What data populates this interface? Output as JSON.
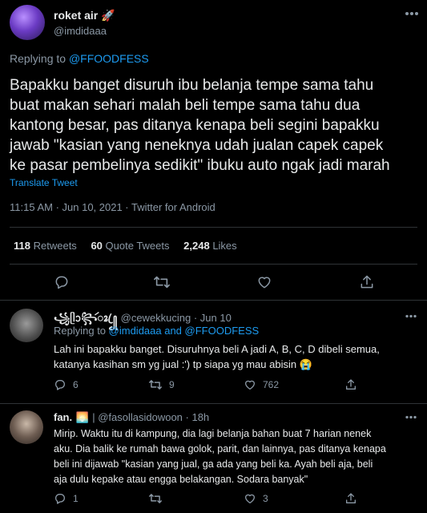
{
  "tweet": {
    "author_name": "roket air",
    "author_emoji": "🚀",
    "author_handle": "@imdidaaa",
    "replying_prefix": "Replying to ",
    "replying_to": "@FFOODFESS",
    "text_lines": [
      "Bapakku banget disuruh ibu belanja tempe sama tahu",
      "buat makan sehari malah beli tempe sama tahu dua",
      "kantong besar, pas ditanya kenapa beli segini bapakku",
      "jawab \"kasian yang neneknya udah jualan capek capek",
      "ke pasar pembelinya sedikit\" ibuku auto ngak jadi marah"
    ],
    "translate_label": "Translate Tweet",
    "timestamp": "11:15 AM · Jun 10, 2021 · Twitter for Android",
    "retweets_count": "118",
    "retweets_label": "Retweets",
    "quotes_count": "60",
    "quotes_label": "Quote Tweets",
    "likes_count": "2,248",
    "likes_label": "Likes"
  },
  "replies": [
    {
      "author_name": "꧁ᥫᩣ꧂ꦂꦴ ꦿ꧀",
      "author_handle": "@cewekkucing · Jun 10",
      "replying_prefix": "Replying to ",
      "replying_to": "@imdidaaa and @FFOODFESS",
      "text_lines": [
        "Lah ini bapakku banget. Disuruhnya beli A jadi A, B, C, D dibeli semua,",
        "katanya kasihan sm yg jual :') tp siapa yg mau abisin 😭"
      ],
      "reply_count": "6",
      "retweet_count": "9",
      "like_count": "762"
    },
    {
      "author_name": "fan.",
      "author_emoji": "🌅",
      "author_handle": "| @fasollasidowoon · 18h",
      "text_lines": [
        "Mirip. Waktu itu di kampung, dia lagi belanja bahan buat 7 harian nenek",
        "aku. Dia balik ke rumah bawa golok, parit, dan lainnya, pas ditanya kenapa",
        "beli ini dijawab \"kasian yang jual, ga ada yang beli ka. Ayah beli aja, beli",
        "aja dulu kepake atau engga belakangan. Sodara banyak\""
      ],
      "reply_count": "1",
      "retweet_count": "",
      "like_count": "3"
    }
  ],
  "icons": {
    "more": "more-icon",
    "reply": "reply-icon",
    "retweet": "retweet-icon",
    "like": "like-icon",
    "share": "share-icon"
  },
  "colors": {
    "background": "#000000",
    "link": "#1d9bf0",
    "text": "#e7e9ea",
    "muted": "#8b98a5",
    "divider": "#2f3336"
  }
}
